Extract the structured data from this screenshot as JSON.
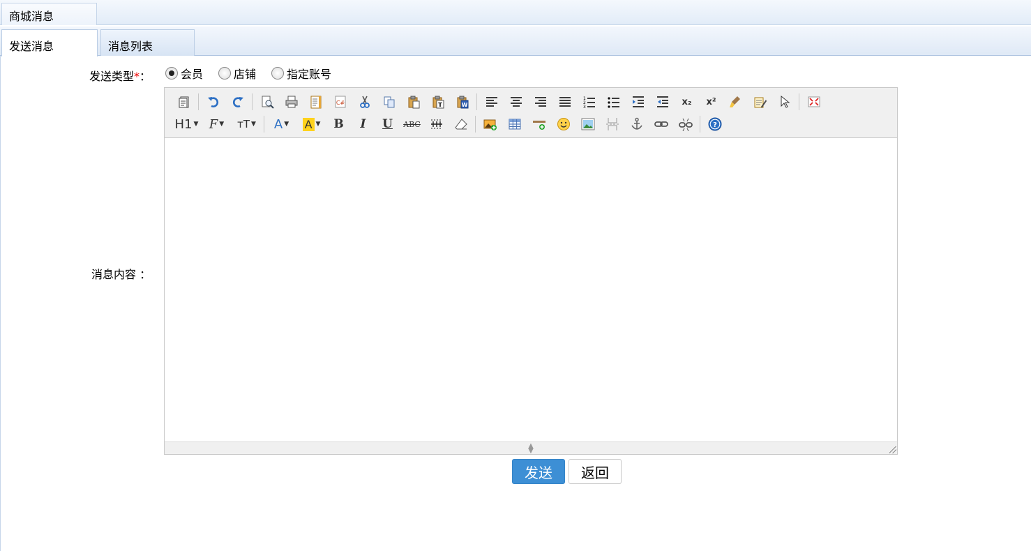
{
  "window": {
    "title": "商城消息"
  },
  "tabs": [
    {
      "label": "发送消息",
      "active": true
    },
    {
      "label": "消息列表",
      "active": false
    }
  ],
  "form": {
    "send_type": {
      "label": "发送类型",
      "required_mark": "*",
      "colon": "：",
      "options": [
        "会员",
        "店铺",
        "指定账号"
      ],
      "selected": "会员"
    },
    "content": {
      "label": "消息内容 ：",
      "value": ""
    }
  },
  "editor": {
    "toolbar_text": {
      "heading": "H1",
      "font_family": "F",
      "font_size": "тT",
      "font_color": "A",
      "bg_color": "A",
      "bold": "B",
      "italic": "I",
      "underline": "U",
      "strike": "ABC",
      "subscript": "x₂",
      "superscript": "x²"
    },
    "toolbar_row1": [
      "source-icon",
      "undo-icon",
      "redo-icon",
      "preview-icon",
      "print-icon",
      "template-icon",
      "code-icon",
      "cut-icon",
      "copy-icon",
      "paste-icon",
      "paste-text-icon",
      "paste-word-icon",
      "align-left-icon",
      "align-center-icon",
      "align-right-icon",
      "align-justify-icon",
      "ordered-list-icon",
      "unordered-list-icon",
      "indent-icon",
      "outdent-icon",
      "subscript-icon",
      "superscript-icon",
      "clear-format-icon",
      "quick-format-icon",
      "select-all-icon",
      "fullscreen-icon"
    ],
    "toolbar_row2": [
      "heading-icon",
      "font-family-icon",
      "font-size-icon",
      "font-color-icon",
      "highlight-color-icon",
      "bold-icon",
      "italic-icon",
      "underline-icon",
      "strikethrough-icon",
      "line-height-icon",
      "remove-format-icon",
      "multi-image-icon",
      "table-icon",
      "hr-icon",
      "emoticon-icon",
      "image-icon",
      "page-break-icon",
      "anchor-icon",
      "link-icon",
      "unlink-icon",
      "help-icon"
    ]
  },
  "buttons": {
    "send": "发送",
    "back": "返回"
  },
  "colors": {
    "primary": "#3d8fd5",
    "required": "#e00000",
    "tab_border": "#b9cce4"
  }
}
